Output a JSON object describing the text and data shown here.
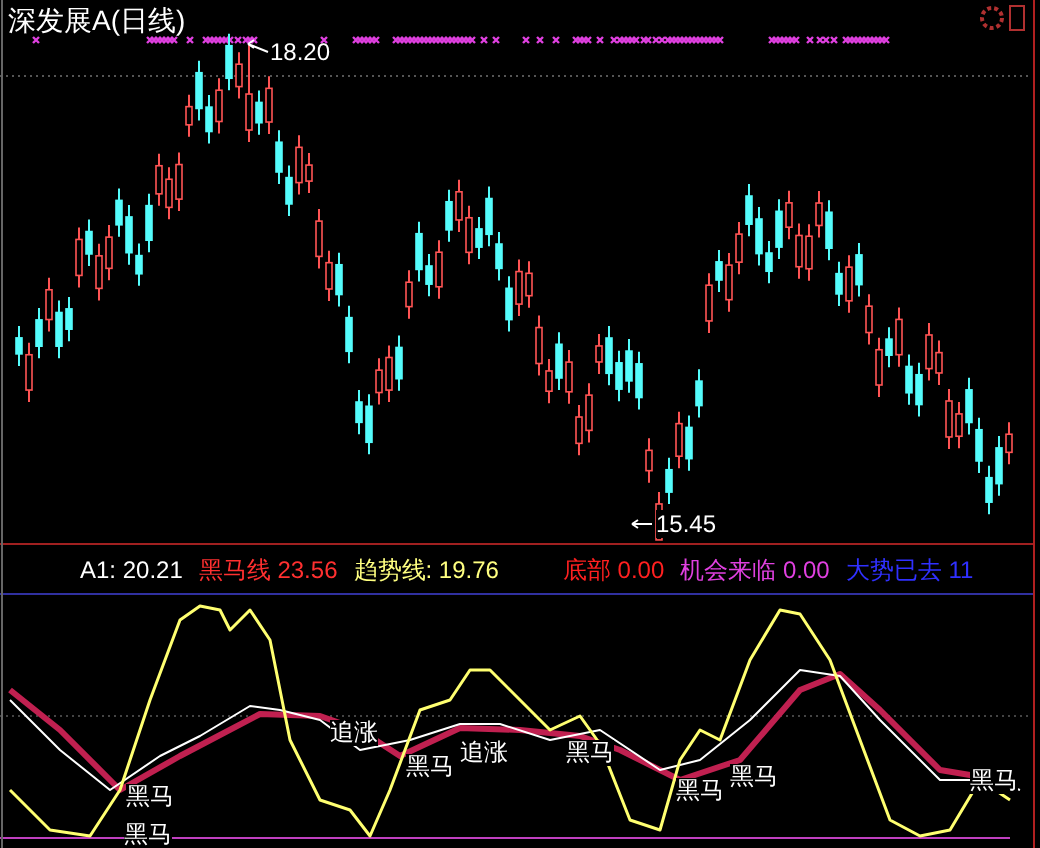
{
  "chart": {
    "title": "深发展A(日线)",
    "high_label": "18.20",
    "low_label": "15.45"
  },
  "indicator": {
    "readings": [
      {
        "label": "A1:",
        "value": "20.21",
        "color": "#ffffff"
      },
      {
        "label": "黑马线",
        "value": "23.56",
        "color": "#ff3030"
      },
      {
        "label": "趋势线:",
        "value": "19.76",
        "color": "#ffff80"
      },
      {
        "label": "底部",
        "value": "0.00",
        "color": "#ff2020"
      },
      {
        "label": "机会来临",
        "value": "0.00",
        "color": "#e040e0"
      },
      {
        "label": "大势已去",
        "value": "11",
        "color": "#3030ff"
      }
    ],
    "signals": [
      {
        "text": "黑马"
      },
      {
        "text": "黑马"
      },
      {
        "text": "追涨"
      },
      {
        "text": "黑马"
      },
      {
        "text": "追涨"
      },
      {
        "text": "黑马"
      },
      {
        "text": "黑马"
      },
      {
        "text": "黑马"
      },
      {
        "text": "黑马"
      }
    ]
  }
}
